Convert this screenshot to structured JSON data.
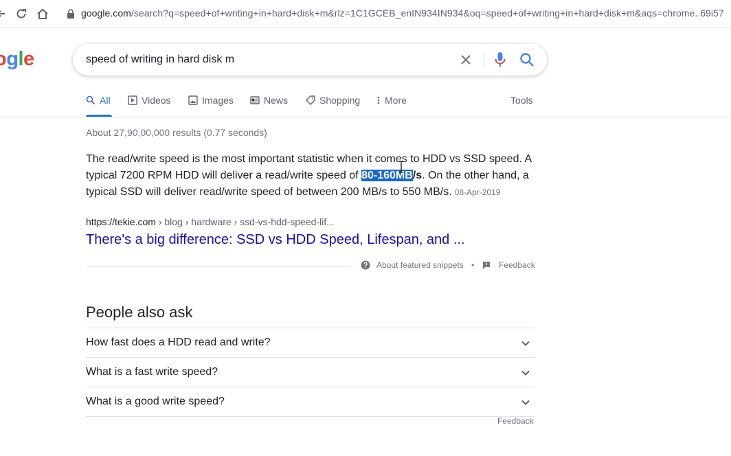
{
  "browser": {
    "url_host": "google.com",
    "url_rest": "/search?q=speed+of+writing+in+hard+disk+m&rlz=1C1GCEB_enIN934IN934&oq=speed+of+writing+in+hard+disk+m&aqs=chrome..69i57"
  },
  "logo": {
    "text_o": "o",
    "text_g": "g",
    "text_l": "l",
    "text_e": "e"
  },
  "search": {
    "query": "speed of writing in hard disk m"
  },
  "tabs": [
    {
      "label": "All"
    },
    {
      "label": "Videos"
    },
    {
      "label": "Images"
    },
    {
      "label": "News"
    },
    {
      "label": "Shopping"
    },
    {
      "label": "More"
    }
  ],
  "tools_label": "Tools",
  "result_stats": "About 27,90,00,000 results (0.77 seconds)",
  "snippet": {
    "text_before": "The read/write speed is the most important statistic when it comes to HDD vs SSD speed. A typical 7200 RPM HDD will deliver a read/write speed of ",
    "highlight_selected": "80-160MB",
    "highlight_rest": "/s",
    "text_after": ". On the other hand, a typical SSD will deliver read/write speed of between 200 MB/s to 550 MB/s.",
    "date": "08-Apr-2019"
  },
  "result": {
    "cite_host": "https://tekie.com",
    "cite_path": " › blog › hardware › ssd-vs-hdd-speed-lif...",
    "title": "There's a big difference: SSD vs HDD Speed, Lifespan, and ..."
  },
  "snippet_footer": {
    "about_label": "About featured snippets",
    "separator": "•",
    "feedback_label": "Feedback"
  },
  "people_also_ask": {
    "title": "People also ask",
    "questions": [
      "How fast does a HDD read and write?",
      "What is a fast write speed?",
      "What is a good write speed?"
    ],
    "feedback_label": "Feedback"
  },
  "colors": {
    "link": "#1a0dab",
    "accent": "#1a73e8",
    "selection": "#1967d2"
  }
}
